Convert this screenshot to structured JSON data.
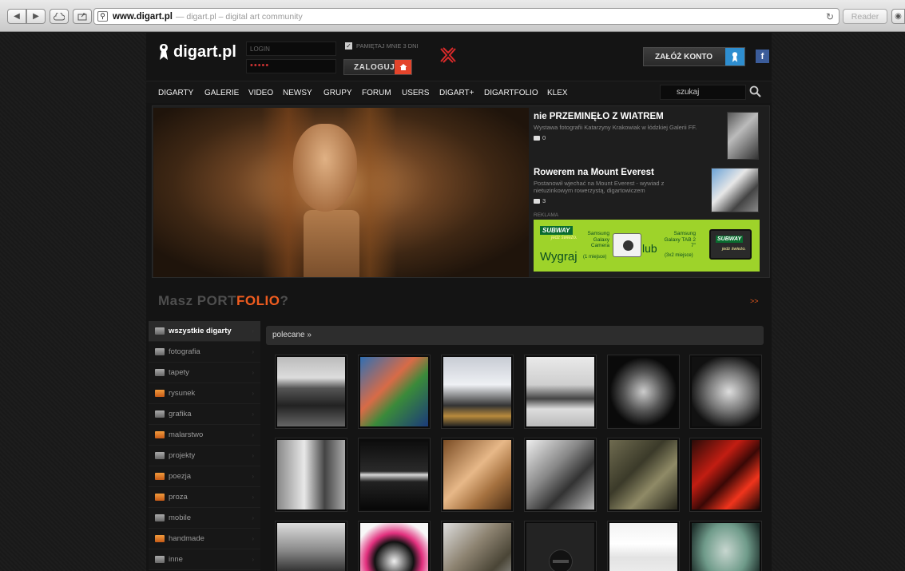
{
  "browser": {
    "url": "www.digart.pl",
    "title": "— digart.pl – digital art community",
    "reader": "Reader"
  },
  "header": {
    "logo": "digart.pl",
    "login_placeholder": "LOGIN",
    "password_mask": "•••••",
    "remember": "PAMIĘTAJ MNIE 3 DNI",
    "login_button": "ZALOGUJ",
    "register_button": "ZAŁÓŻ KONTO",
    "facebook": "f"
  },
  "nav": {
    "items": [
      "DIGARTY",
      "GALERIE",
      "VIDEO",
      "NEWSY",
      "GRUPY",
      "FORUM",
      "USERS",
      "DIGART+",
      "DIGARTFOLIO",
      "KLEX"
    ],
    "search_value": "szukaj"
  },
  "news": [
    {
      "title": "nie PRZEMINĘŁO Z WIATREM",
      "text": "Wystawa fotografii Katarzyny Krakowiak w łódzkiej Galerii FF.",
      "comments": "0"
    },
    {
      "title": "Rowerem na Mount Everest",
      "text": "Postanowił wjechać na Mount Everest - wywiad z nietuzinkowym rowerzystą, digartowiczem",
      "comments": "3"
    }
  ],
  "ad": {
    "label": "REKLAMA",
    "brand": "SUBWAY",
    "slogan": "jedz świeżo.",
    "cta": "Wygraj",
    "prize1": "Samsung Galaxy Camera",
    "prize1_sub": "(1 miejsce)",
    "or": "lub",
    "prize2": "Samsung Galaxy TAB 2 7\"",
    "prize2_sub": "(3x2 miejsce)"
  },
  "portfolio": {
    "part1": "Masz PORT",
    "part2": "FOLIO",
    "part3": "?",
    "more": ">>"
  },
  "sidebar": [
    {
      "label": "wszystkie digarty",
      "active": true,
      "color": "gray"
    },
    {
      "label": "fotografia",
      "color": "gray"
    },
    {
      "label": "tapety",
      "color": "gray"
    },
    {
      "label": "rysunek",
      "color": "orange"
    },
    {
      "label": "grafika",
      "color": "gray"
    },
    {
      "label": "malarstwo",
      "color": "orange"
    },
    {
      "label": "projekty",
      "color": "gray"
    },
    {
      "label": "poezja",
      "color": "orange"
    },
    {
      "label": "proza",
      "color": "orange"
    },
    {
      "label": "mobile",
      "color": "gray"
    },
    {
      "label": "handmade",
      "color": "orange"
    },
    {
      "label": "inne",
      "color": "gray"
    }
  ],
  "section_title": "polecane »",
  "thumbnails": [
    {
      "name": "thumb-desert-landscape",
      "bg": "linear-gradient(#bbb 0%, #ddd 30%, #555 45%, #222 70%, #666)"
    },
    {
      "name": "thumb-woman-colors",
      "bg": "linear-gradient(135deg, #2f6fb3, #d86b47 40%, #3a8a3a 60%, #1b3a7a)"
    },
    {
      "name": "thumb-figure-doorway",
      "bg": "linear-gradient(#c8ccd4 0%, #eef0f4 40%, #333 70%, #b88a3c 85%, #222)"
    },
    {
      "name": "thumb-tower-bw",
      "bg": "linear-gradient(#e9e9e9 0%, #cfcfcf 40%, #444 60%, #ddd 75%, #bbb)"
    },
    {
      "name": "thumb-crouching-figure",
      "bg": "radial-gradient(ellipse at 50% 50%, #ccc, #555 40%, #0a0a0a 70%)"
    },
    {
      "name": "thumb-sculpture-bw",
      "bg": "radial-gradient(ellipse at 55% 50%, #ddd, #777 40%, #111 75%)"
    },
    {
      "name": "thumb-two-men",
      "bg": "linear-gradient(90deg, #888, #e8e8e8 40%, #444 70%, #aaa)"
    },
    {
      "name": "thumb-dark-reflection",
      "bg": "linear-gradient(#0c0c0c 0%, #2a2a2a 45%, #d9d9d9 50%, #222 60%, #070707)"
    },
    {
      "name": "thumb-warm-body",
      "bg": "linear-gradient(135deg, #7a4c24, #e7b888 45%, #a5713f 70%, #4b2d14)"
    },
    {
      "name": "thumb-woman-bw",
      "bg": "linear-gradient(135deg, #eee, #888 40%, #333 65%, #bbb)"
    },
    {
      "name": "thumb-tree-roots",
      "bg": "linear-gradient(135deg, #6f6b50, #3b3a29 40%, #8f8a66 65%, #26251a)"
    },
    {
      "name": "thumb-red-art",
      "bg": "linear-gradient(135deg, #2a0b08, #c21d12 35%, #3a0806 55%, #f0341c 75%, #150504)"
    },
    {
      "name": "thumb-dancer",
      "bg": "linear-gradient(#ddd 0%, #888 40%, #222 75%, #555)"
    },
    {
      "name": "thumb-wolf",
      "bg": "radial-gradient(circle at 50% 55%, #f0f0f0 0%, #111 38%, #e2307e 55%, #f7f7f7 80%)"
    },
    {
      "name": "thumb-statue",
      "bg": "linear-gradient(135deg, #ddd, #8c8270 40%, #4a4536 70%, #aaa)"
    },
    {
      "name": "thumb-placeholder",
      "bg": "#232323"
    },
    {
      "name": "thumb-website",
      "bg": "linear-gradient(#f2f2f2 0%, #fff 30%, #e3e3e3 50%, #f8f8f8)"
    },
    {
      "name": "thumb-cartoon-character",
      "bg": "radial-gradient(ellipse at 50% 40%, #c7d6cf, #6f9b8a 45%, #1d2e2a 80%)"
    }
  ]
}
